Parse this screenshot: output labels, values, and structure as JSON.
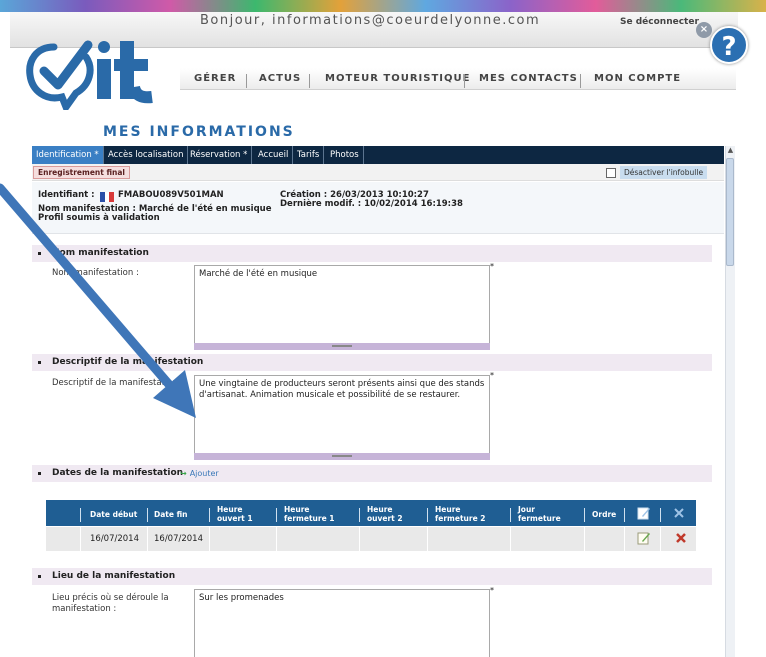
{
  "header": {
    "greeting": "Bonjour, informations@coeurdelyonne.com",
    "logout": "Se déconnecter",
    "close_glyph": "×",
    "help_glyph": "?"
  },
  "nav": {
    "items": [
      "GÉRER",
      "ACTUS",
      "MOTEUR TOURISTIQUE",
      "MES CONTACTS",
      "MON COMPTE"
    ]
  },
  "page_title": "MES INFORMATIONS",
  "tabs": [
    {
      "label": "Identification *",
      "active": true
    },
    {
      "label": "Accès localisation",
      "active": false
    },
    {
      "label": "Réservation *",
      "active": false
    },
    {
      "label": "Accueil",
      "active": false
    },
    {
      "label": "Tarifs",
      "active": false
    },
    {
      "label": "Photos",
      "active": false
    }
  ],
  "toolbar": {
    "save_label": "Enregistrement final",
    "infobulle_label": "Désactiver l'infobulle",
    "infobulle_checked": false
  },
  "info": {
    "identifiant_label": "Identifiant :",
    "identifiant_value": "FMABOU089V501MAN",
    "nom_line": "Nom manifestation : Marché de l'été en musique",
    "profil_line": "Profil soumis à validation",
    "creation_line": "Création : 26/03/2013 10:10:27",
    "modif_line": "Dernière modif. : 10/02/2014 16:19:38"
  },
  "sections": {
    "nom": {
      "title": "Nom manifestation",
      "field_label": "Nom manifestation :",
      "value": "Marché de l'été en musique"
    },
    "descriptif": {
      "title": "Descriptif de la manifestation",
      "field_label": "Descriptif de la manifestation",
      "value": "Une vingtaine de producteurs seront présents ainsi que des stands d'artisanat. Animation musicale et possibilité de se restaurer."
    },
    "dates": {
      "title": "Dates de la manifestation",
      "add_label": "Ajouter",
      "columns": [
        "Date début",
        "Date fin",
        "Heure ouvert 1",
        "Heure fermeture 1",
        "Heure ouvert 2",
        "Heure fermeture 2",
        "Jour fermeture",
        "Ordre"
      ],
      "rows": [
        [
          "16/07/2014",
          "16/07/2014",
          "",
          "",
          "",
          "",
          "",
          ""
        ]
      ]
    },
    "lieu": {
      "title": "Lieu de la manifestation",
      "field_label": "Lieu précis où se déroule la manifestation :",
      "value": "Sur les promenades"
    }
  },
  "required_mark": "*",
  "colors": {
    "accent": "#2a6aa8",
    "tab_bar": "#0d2742",
    "tab_active": "#3a7fc4",
    "section_bg": "#f0e9f2",
    "table_header": "#1f5e93",
    "annotation_arrow": "#3f76b8"
  }
}
